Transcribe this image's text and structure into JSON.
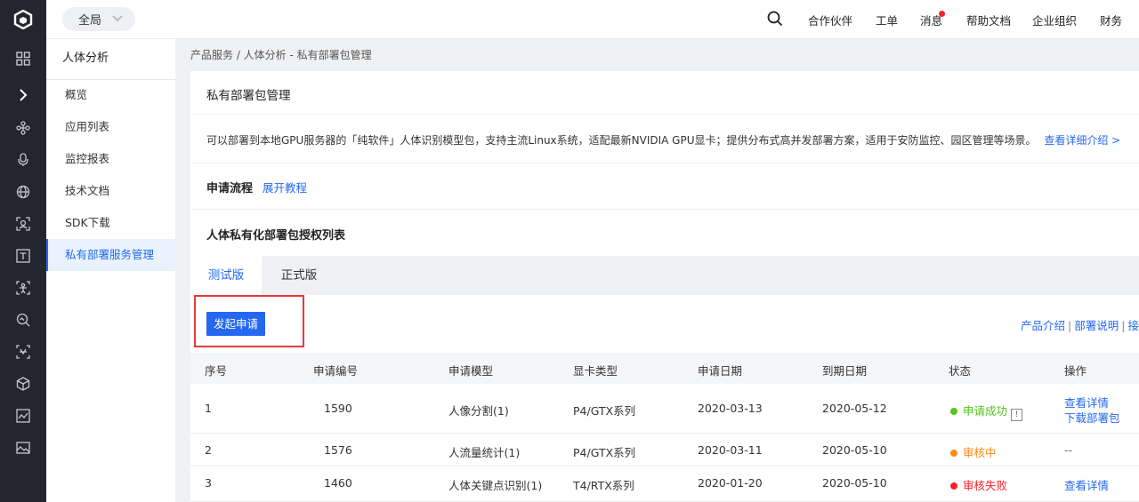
{
  "topbar": {
    "scope_label": "全局",
    "nav": [
      "合作伙伴",
      "工单",
      "消息",
      "帮助文档",
      "企业组织",
      "财务"
    ]
  },
  "rail": {
    "icons": [
      "logo-icon",
      "grid-icon",
      "expand-icon",
      "network-icon",
      "microphone-icon",
      "globe-icon",
      "face-scan-icon",
      "text-icon",
      "body-icon",
      "search-image-icon",
      "scan-icon",
      "cube-icon",
      "image-chart-icon",
      "image-icon"
    ]
  },
  "subnav": {
    "title": "人体分析",
    "items": [
      "概览",
      "应用列表",
      "监控报表",
      "技术文档",
      "SDK下载",
      "私有部署服务管理"
    ],
    "active_index": 5
  },
  "breadcrumb": "产品服务 / 人体分析 - 私有部署包管理",
  "page": {
    "title": "私有部署包管理",
    "description": "可以部署到本地GPU服务器的「纯软件」人体识别模型包，支持主流Linux系统，适配最新NVIDIA GPU显卡；提供分布式高并发部署方案，适用于安防监控、园区管理等场景。",
    "description_link": "查看详细介绍 >",
    "process_title": "申请流程",
    "process_link": "展开教程",
    "list_title": "人体私有化部署包授权列表"
  },
  "tabs": [
    "测试版",
    "正式版"
  ],
  "actions": {
    "apply_button": "发起申请",
    "links": [
      "产品介绍",
      "部署说明",
      "接口"
    ]
  },
  "table": {
    "headers": [
      "序号",
      "申请编号",
      "申请模型",
      "显卡类型",
      "申请日期",
      "到期日期",
      "状态",
      "操作"
    ],
    "rows": [
      {
        "idx": "1",
        "code": "1590",
        "model": "人像分割(1)",
        "gpu": "P4/GTX系列",
        "apply_date": "2020-03-13",
        "expire_date": "2020-05-12",
        "status": "申请成功",
        "status_color": "#52c41a",
        "ops": [
          "查看详情",
          "下载部署包"
        ]
      },
      {
        "idx": "2",
        "code": "1576",
        "model": "人流量统计(1)",
        "gpu": "P4/GTX系列",
        "apply_date": "2020-03-11",
        "expire_date": "2020-05-10",
        "status": "审核中",
        "status_color": "#fa8c16",
        "ops": [
          "--"
        ]
      },
      {
        "idx": "3",
        "code": "1460",
        "model": "人体关键点识别(1)",
        "gpu": "T4/RTX系列",
        "apply_date": "2020-01-20",
        "expire_date": "2020-05-10",
        "status": "审核失败",
        "status_color": "#f5222d",
        "ops": [
          "查看详情"
        ]
      }
    ]
  },
  "colors": {
    "accent": "#2468f2",
    "rail_bg": "#24262f",
    "highlight": "#e63a3a"
  }
}
